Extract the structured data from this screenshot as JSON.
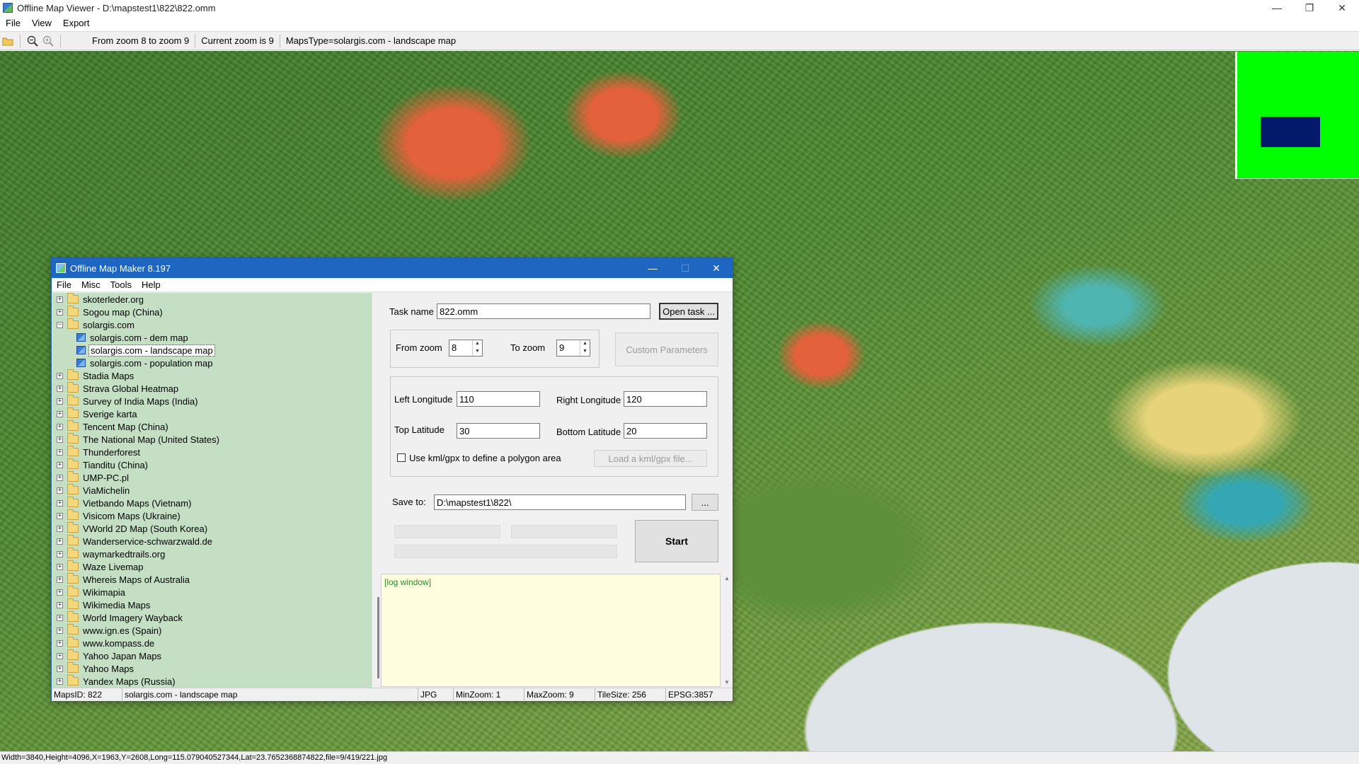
{
  "viewer": {
    "title": "Offline Map Viewer - D:\\mapstest1\\822\\822.omm",
    "menu": [
      "File",
      "View",
      "Export"
    ],
    "toolbar": {
      "zoom_range": "From zoom 8 to zoom 9",
      "current_zoom": "Current zoom is 9",
      "maps_type": "MapsType=solargis.com - landscape map"
    },
    "window_controls": {
      "minimize": "—",
      "restore": "❐",
      "close": "✕"
    },
    "status": "Width=3840,Height=4096,X=1963,Y=2608,Long=115.079040527344,Lat=23.7652368874822,file=9/419/221.jpg",
    "minimap": {
      "bg_color": "#00ff00",
      "viewport_color": "#031a6b"
    }
  },
  "maker": {
    "title": "Offline Map Maker 8.197",
    "menu": [
      "File",
      "Misc",
      "Tools",
      "Help"
    ],
    "window_controls": {
      "minimize": "—",
      "maximize": "☐",
      "close": "✕"
    },
    "tree": [
      {
        "label": "skoterleder.org",
        "type": "folder",
        "expanded": false
      },
      {
        "label": "Sogou map (China)",
        "type": "folder",
        "expanded": false
      },
      {
        "label": "solargis.com",
        "type": "folder",
        "expanded": true
      },
      {
        "label": "solargis.com - dem map",
        "type": "map",
        "selected": false
      },
      {
        "label": "solargis.com - landscape map",
        "type": "map",
        "selected": true
      },
      {
        "label": "solargis.com - population map",
        "type": "map",
        "selected": false
      },
      {
        "label": "Stadia Maps",
        "type": "folder",
        "expanded": false
      },
      {
        "label": "Strava Global Heatmap",
        "type": "folder",
        "expanded": false
      },
      {
        "label": "Survey of India Maps (India)",
        "type": "folder",
        "expanded": false
      },
      {
        "label": "Sverige karta",
        "type": "folder",
        "expanded": false
      },
      {
        "label": "Tencent Map (China)",
        "type": "folder",
        "expanded": false
      },
      {
        "label": "The National Map (United States)",
        "type": "folder",
        "expanded": false
      },
      {
        "label": "Thunderforest",
        "type": "folder",
        "expanded": false
      },
      {
        "label": "Tianditu (China)",
        "type": "folder",
        "expanded": false
      },
      {
        "label": "UMP-PC.pl",
        "type": "folder",
        "expanded": false
      },
      {
        "label": "ViaMichelin",
        "type": "folder",
        "expanded": false
      },
      {
        "label": "Vietbando Maps (Vietnam)",
        "type": "folder",
        "expanded": false
      },
      {
        "label": "Visicom Maps (Ukraine)",
        "type": "folder",
        "expanded": false
      },
      {
        "label": "VWorld 2D Map (South Korea)",
        "type": "folder",
        "expanded": false
      },
      {
        "label": "Wanderservice-schwarzwald.de",
        "type": "folder",
        "expanded": false
      },
      {
        "label": "waymarkedtrails.org",
        "type": "folder",
        "expanded": false
      },
      {
        "label": "Waze Livemap",
        "type": "folder",
        "expanded": false
      },
      {
        "label": "Whereis Maps of Australia",
        "type": "folder",
        "expanded": false
      },
      {
        "label": "Wikimapia",
        "type": "folder",
        "expanded": false
      },
      {
        "label": "Wikimedia Maps",
        "type": "folder",
        "expanded": false
      },
      {
        "label": "World Imagery Wayback",
        "type": "folder",
        "expanded": false
      },
      {
        "label": "www.ign.es (Spain)",
        "type": "folder",
        "expanded": false
      },
      {
        "label": "www.kompass.de",
        "type": "folder",
        "expanded": false
      },
      {
        "label": "Yahoo Japan Maps",
        "type": "folder",
        "expanded": false
      },
      {
        "label": "Yahoo Maps",
        "type": "folder",
        "expanded": false
      },
      {
        "label": "Yandex Maps (Russia)",
        "type": "folder",
        "expanded": false
      }
    ],
    "task": {
      "label": "Task name",
      "value": "822.omm",
      "open_button": "Open task ..."
    },
    "zoom": {
      "from_label": "From zoom",
      "from_value": "8",
      "to_label": "To zoom",
      "to_value": "9",
      "custom_button": "Custom Parameters"
    },
    "area": {
      "left_lon_label": "Left Longitude",
      "left_lon": "110",
      "right_lon_label": "Right Longitude",
      "right_lon": "120",
      "top_lat_label": "Top Latitude",
      "top_lat": "30",
      "bottom_lat_label": "Bottom Latitude",
      "bottom_lat": "20",
      "kml_label": "Use kml/gpx to define a polygon area",
      "kml_checked": false,
      "load_kml_button": "Load a kml/gpx file..."
    },
    "save": {
      "label": "Save to:",
      "value": "D:\\mapstest1\\822\\",
      "browse_button": "..."
    },
    "start_button": "Start",
    "log": "[log window]",
    "status": {
      "maps_id": "MapsID: 822",
      "maps_name": "solargis.com - landscape map",
      "format": "JPG",
      "min_zoom": "MinZoom: 1",
      "max_zoom": "MaxZoom: 9",
      "tile_size": "TileSize: 256",
      "epsg": "EPSG:3857"
    }
  }
}
